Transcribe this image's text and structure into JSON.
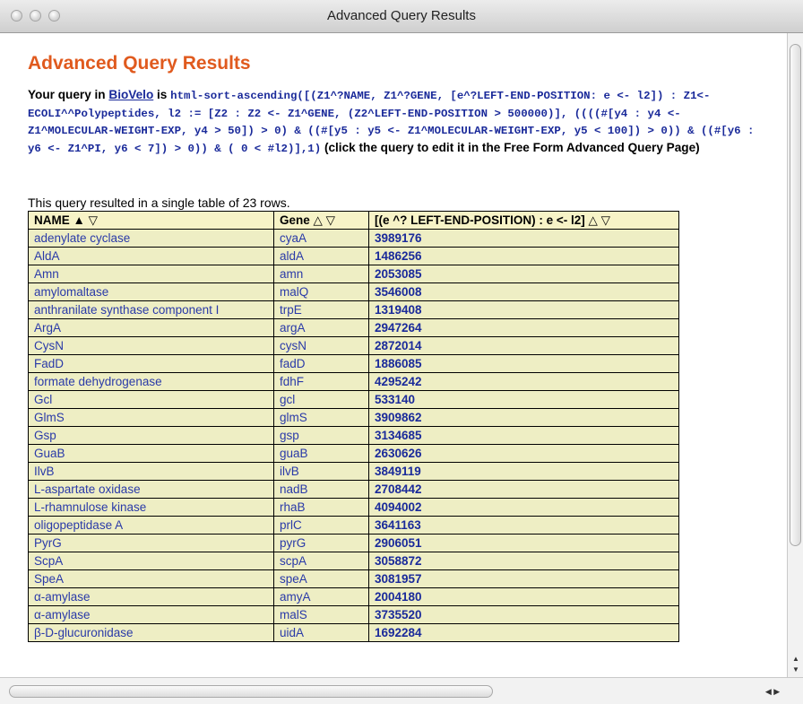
{
  "window": {
    "title": "Advanced Query Results"
  },
  "page": {
    "heading": "Advanced Query Results",
    "query_prefix": "Your query in ",
    "link_text": "BioVelo",
    "query_is": " is ",
    "query_code": "html-sort-ascending([(Z1^?NAME, Z1^?GENE, [e^?LEFT-END-POSITION: e <- l2]) : Z1<-ECOLI^^Polypeptides, l2 := [Z2 : Z2 <- Z1^GENE, (Z2^LEFT-END-POSITION > 500000)], ((((#[y4 : y4 <- Z1^MOLECULAR-WEIGHT-EXP, y4 > 50]) > 0) & ((#[y5 : y5 <- Z1^MOLECULAR-WEIGHT-EXP, y5 < 100]) > 0)) & ((#[y6 : y6 <- Z1^PI, y6 < 7]) > 0)) & ( 0 < #l2)],1)",
    "query_suffix": " (click the query to edit it in the Free Form Advanced Query Page)",
    "result_summary": "This query resulted in a single table of 23 rows."
  },
  "table": {
    "headers": {
      "name": "NAME",
      "name_arrows": "▲ ▽",
      "gene": "Gene",
      "gene_arrows": "△ ▽",
      "pos": "[(e ^? LEFT-END-POSITION) : e <- l2]",
      "pos_arrows": "△ ▽"
    },
    "rows": [
      [
        "adenylate cyclase",
        "cyaA",
        "3989176"
      ],
      [
        "AldA",
        "aldA",
        "1486256"
      ],
      [
        "Amn",
        "amn",
        "2053085"
      ],
      [
        "amylomaltase",
        "malQ",
        "3546008"
      ],
      [
        "anthranilate synthase component I",
        "trpE",
        "1319408"
      ],
      [
        "ArgA",
        "argA",
        "2947264"
      ],
      [
        "CysN",
        "cysN",
        "2872014"
      ],
      [
        "FadD",
        "fadD",
        "1886085"
      ],
      [
        "formate dehydrogenase",
        "fdhF",
        "4295242"
      ],
      [
        "Gcl",
        "gcl",
        "533140"
      ],
      [
        "GlmS",
        "glmS",
        "3909862"
      ],
      [
        "Gsp",
        "gsp",
        "3134685"
      ],
      [
        "GuaB",
        "guaB",
        "2630626"
      ],
      [
        "IlvB",
        "ilvB",
        "3849119"
      ],
      [
        "L-aspartate oxidase",
        "nadB",
        "2708442"
      ],
      [
        "L-rhamnulose kinase",
        "rhaB",
        "4094002"
      ],
      [
        "oligopeptidase A",
        "prlC",
        "3641163"
      ],
      [
        "PyrG",
        "pyrG",
        "2906051"
      ],
      [
        "ScpA",
        "scpA",
        "3058872"
      ],
      [
        "SpeA",
        "speA",
        "3081957"
      ],
      [
        "α-amylase",
        "amyA",
        "2004180"
      ],
      [
        "α-amylase",
        "malS",
        "3735520"
      ],
      [
        "β-D-glucuronidase",
        "uidA",
        "1692284"
      ]
    ]
  },
  "colors": {
    "heading": "#e05a1e",
    "link": "#2a3aa8",
    "header_bg": "#f7f3c7",
    "row_bg": "#eeeec4"
  }
}
